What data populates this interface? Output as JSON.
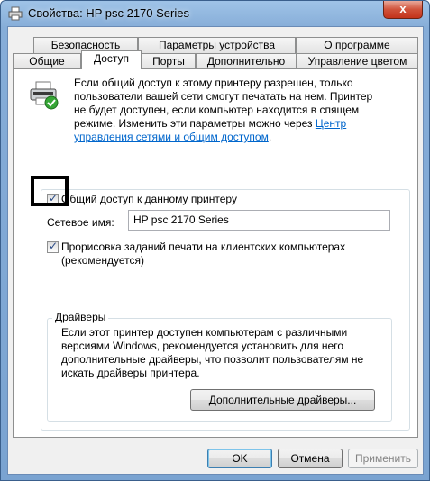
{
  "window": {
    "title": "Свойства: HP psc 2170 Series",
    "close_label": "x"
  },
  "tabs_row1": [
    {
      "label": "Безопасность"
    },
    {
      "label": "Параметры устройства"
    },
    {
      "label": "О программе"
    }
  ],
  "tabs_row2": [
    {
      "label": "Общие"
    },
    {
      "label": "Доступ",
      "active": true
    },
    {
      "label": "Порты"
    },
    {
      "label": "Дополнительно"
    },
    {
      "label": "Управление цветом"
    }
  ],
  "info": {
    "text": "Если общий доступ к этому принтеру разрешен, только пользователи вашей сети смогут печатать на нем. Принтер не будет доступен, если компьютер находится в спящем режиме. Изменить эти параметры можно через ",
    "link": "Центр управления сетями и общим доступом",
    "suffix": "."
  },
  "sharing": {
    "share_checkbox_label": "Общий доступ к данному принтеру",
    "share_checked": true,
    "share_name_label": "Сетевое имя:",
    "share_name_value": "HP psc 2170 Series",
    "render_checkbox_label": "Прорисовка заданий печати на клиентских компьютерах (рекомендуется)",
    "render_checked": true
  },
  "drivers": {
    "group_title": "Драйверы",
    "text": "Если этот принтер доступен компьютерам с различными версиями Windows, рекомендуется установить для него дополнительные драйверы, что позволит пользователям не искать драйверы принтера.",
    "additional_button": "Дополнительные драйверы..."
  },
  "footer": {
    "ok": "OK",
    "cancel": "Отмена",
    "apply": "Применить"
  }
}
